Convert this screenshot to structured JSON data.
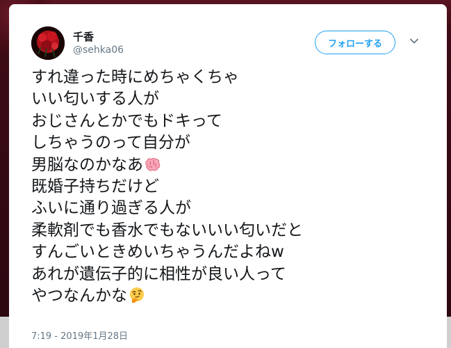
{
  "tweet": {
    "author": {
      "display_name": "千香",
      "handle": "@sehka06"
    },
    "follow_label": "フォローする",
    "lines": [
      "すれ違った時にめちゃくちゃ",
      "いい匂いする人が",
      "おじさんとかでもドキって",
      "しちゃうのって自分が",
      "男脳なのかなあ",
      "既婚子持ちだけど",
      "ふいに通り過ぎる人が",
      "柔軟剤でも香水でもないいい匂いだと",
      "すんごいときめいちゃうんだよねw",
      "あれが遺伝子的に相性が良い人って",
      "やつなんかな"
    ],
    "emojis": {
      "line5": "brain-emoji",
      "line11": "thinking-face-emoji"
    },
    "timestamp": "7:19 - 2019年1月28日"
  },
  "colors": {
    "accent": "#1da1f2",
    "text": "#14171a",
    "secondary_text": "#657786"
  }
}
